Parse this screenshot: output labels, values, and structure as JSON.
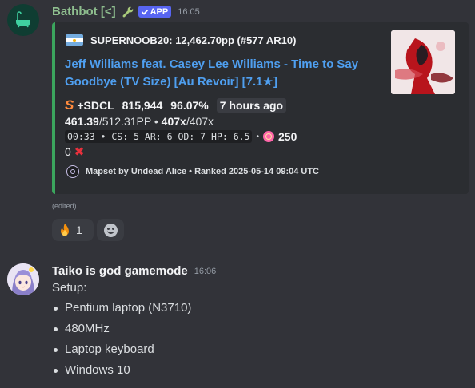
{
  "bot_message": {
    "username": "Bathbot [<]",
    "badge": "APP",
    "timestamp": "16:05",
    "embed": {
      "author": "SUPERNOOB20: 12,462.70pp (#577 AR10)",
      "title": "Jeff Williams feat. Casey Lee Williams - Time to Say Goodbye (TV Size) [Au Revoir] [7.1★]",
      "rank": "S",
      "mods": "+SDCL",
      "score": "815,944",
      "accuracy": "96.07%",
      "time_ago": "7 hours ago",
      "pp": "461.39",
      "pp_max": "/512.31PP",
      "combo_sep": " • ",
      "combo": "407x",
      "combo_max": "/407x",
      "map_stats": "00:33 • CS: 5 AR: 6 OD: 7 HP: 6.5",
      "bullet": "•",
      "max_combo_stars": "250",
      "misses": "0",
      "footer": "Mapset by Undead Alice • Ranked 2025-05-14 09:04 UTC"
    },
    "edited_label": "(edited)",
    "reactions": [
      {
        "icon": "fire-icon",
        "count": "1"
      },
      {
        "icon": "add-reaction-icon",
        "count": ""
      }
    ]
  },
  "user_message": {
    "username": "Taiko is god gamemode",
    "timestamp": "16:06",
    "intro": "Setup:",
    "items": [
      "Pentium laptop (N3710)",
      "480MHz",
      "Laptop keyboard",
      "Windows 10"
    ]
  },
  "colors": {
    "background": "#323339",
    "embed_bg": "#2b2d31",
    "embed_border": "#3ba55d",
    "link": "#4f9ff0",
    "badge": "#5865f2",
    "rank_s": "#ff8a3d",
    "miss": "#e8303c"
  }
}
